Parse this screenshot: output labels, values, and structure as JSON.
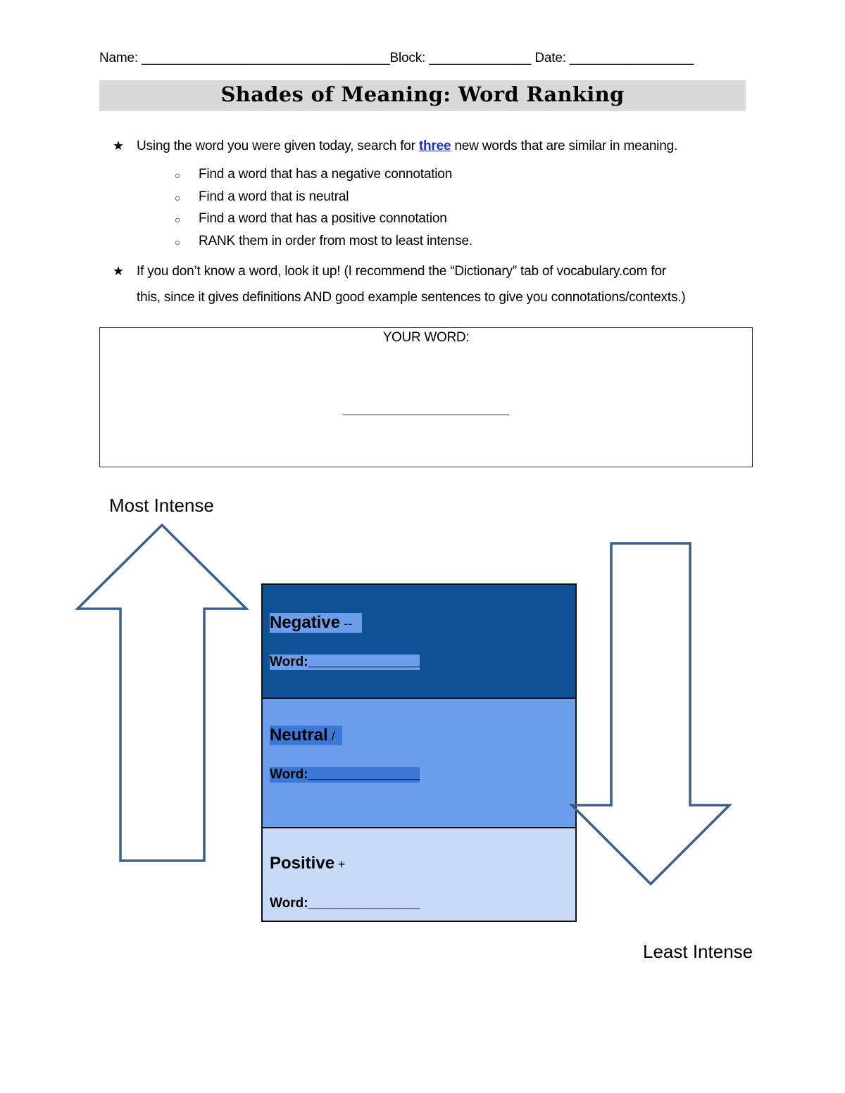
{
  "header": {
    "name_label": "Name: ",
    "name_blank": "__________________________________",
    "block_label": "Block: ",
    "block_blank": "______________",
    "date_label": " Date: ",
    "date_blank": "_________________"
  },
  "title": "Shades of Meaning: Word Ranking",
  "instructions": {
    "bullet_icon": "★",
    "sub_bullet_icon": "○",
    "item1_before": "Using the word you were given today, search for ",
    "item1_link": "three",
    "item1_after": " new words that are similar in meaning.",
    "sub_items": [
      "Find a word that has a negative connotation",
      "Find a word that is neutral",
      "Find a word that has a positive connotation",
      "RANK them in order from most to least intense."
    ],
    "item2_line1": "If you don’t know a word, look it up! (I recommend the “Dictionary” tab of vocabulary.com for",
    "item2_line2": "this, since it gives definitions AND good example sentences to give you connotations/contexts.)"
  },
  "your_word": {
    "label": "YOUR WORD:"
  },
  "scale": {
    "top_label": "Most Intense",
    "bottom_label": "Least Intense"
  },
  "ranking": {
    "word_label": "Word:",
    "word_blank": "_______________",
    "rows": [
      {
        "label": "Negative",
        "symbol": " --",
        "color": "#0e5195"
      },
      {
        "label": "Neutral",
        "symbol": " /",
        "color": "#6d9eeb"
      },
      {
        "label": "Positive",
        "symbol": " +",
        "color": "#c9daf8"
      }
    ]
  },
  "colors": {
    "arrow_stroke": "#3c5e8c",
    "title_bar": "#d9d9d9",
    "link": "#1a34c8"
  }
}
